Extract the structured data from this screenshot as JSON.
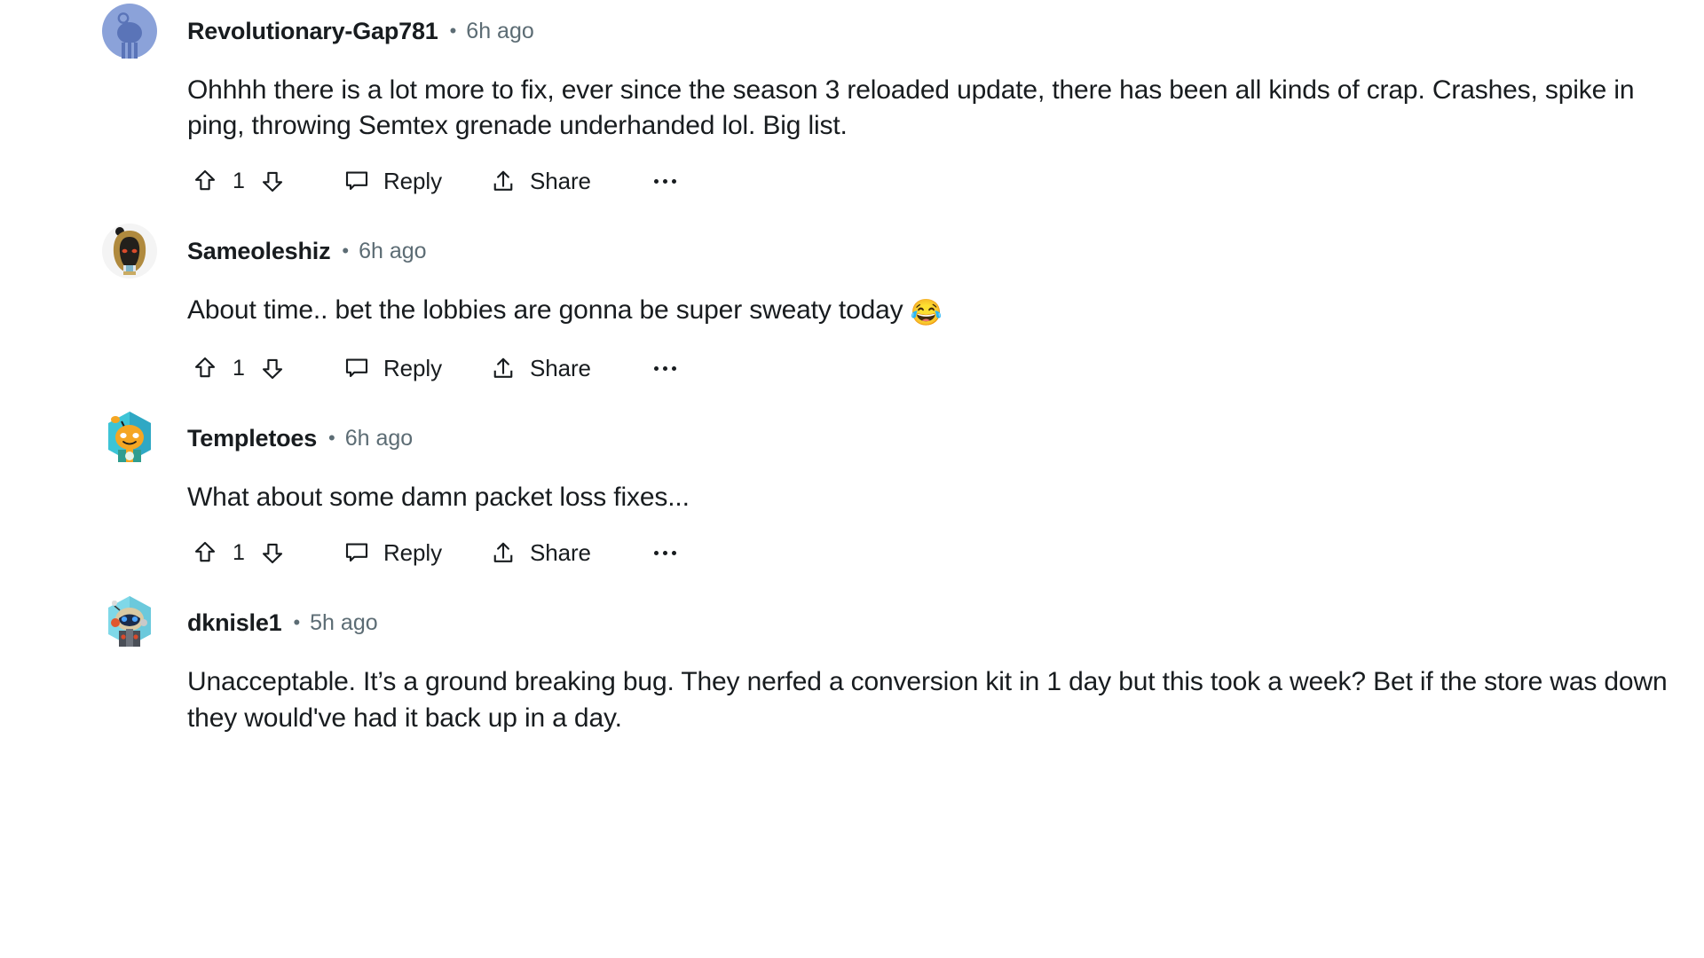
{
  "page": {
    "platform": "reddit-comments",
    "background": "#ffffff",
    "text_color": "#181c1f",
    "muted_color": "#5c6c74"
  },
  "actions": {
    "upvote_icon": "upvote-arrow-icon",
    "downvote_icon": "downvote-arrow-icon",
    "reply_icon": "comment-bubble-icon",
    "reply_label": "Reply",
    "share_icon": "share-arrow-icon",
    "share_label": "Share",
    "more_icon": "more-horizontal-icon"
  },
  "comments": [
    {
      "username": "Revolutionary-Gap781",
      "separator": "•",
      "timestamp": "6h ago",
      "body": "Ohhhh there is a lot more to fix, ever since the season 3 reloaded update, there has been all kinds of crap. Crashes, spike in ping, throwing Semtex grenade underhanded lol. Big list.",
      "vote_count": "1",
      "avatar": {
        "name": "avatar-default-snoo",
        "style": "default-blue-snoo",
        "bg": "#8BA2D9",
        "fg": "#5A74B8"
      }
    },
    {
      "username": "Sameoleshiz",
      "separator": "•",
      "timestamp": "6h ago",
      "body": "About time.. bet the lobbies are gonna be super sweaty today ",
      "body_emoji": "😂",
      "vote_count": "1",
      "avatar": {
        "name": "avatar-hooded-snoo",
        "style": "hooded-dark",
        "bg": "#ffffff",
        "fg": "#B08A3E"
      }
    },
    {
      "username": "Templetoes",
      "separator": "•",
      "timestamp": "6h ago",
      "body": "What about some damn packet loss fixes...",
      "vote_count": "1",
      "avatar": {
        "name": "avatar-orange-snoo",
        "style": "orange-hex",
        "bg": "#3DC4D6",
        "fg": "#F5A623"
      }
    },
    {
      "username": "dknisle1",
      "separator": "•",
      "timestamp": "5h ago",
      "body": "Unacceptable. It’s a ground breaking bug. They nerfed a conversion kit in 1 day but this took a week? Bet if the store was down they would've had it back up in a day.",
      "vote_count": null,
      "avatar": {
        "name": "avatar-astronaut-snoo",
        "style": "astronaut-hex",
        "bg": "#7FD8E8",
        "fg": "#D9C9A3"
      }
    }
  ]
}
